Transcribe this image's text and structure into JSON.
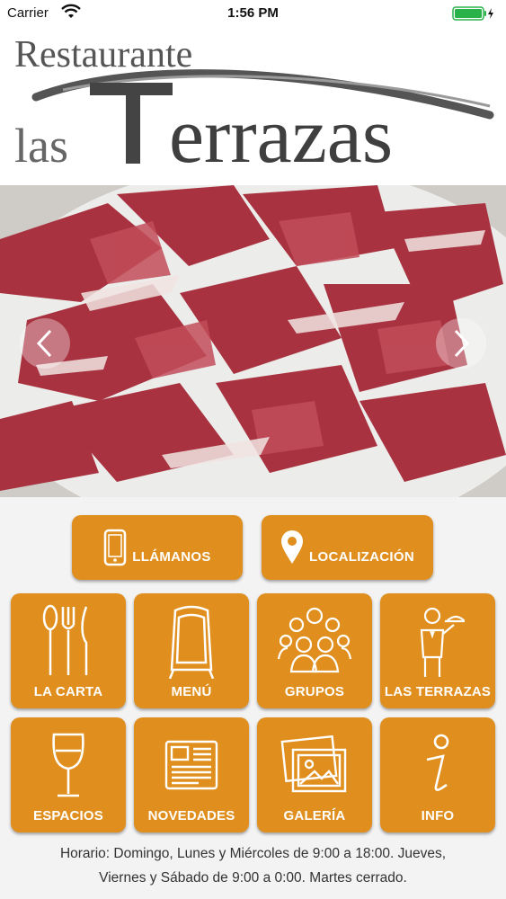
{
  "status_bar": {
    "carrier": "Carrier",
    "time": "1:56 PM"
  },
  "logo": {
    "line1": "Restaurante",
    "line2_small": "las",
    "line2_big": "errazas",
    "brand_color": "#4a4a4a"
  },
  "carousel": {
    "image_description_icon": "jamon-photo",
    "prev_icon": "chevron-left-icon",
    "next_icon": "chevron-right-icon"
  },
  "actions": {
    "call_label": "LLÁMANOS",
    "location_label": "LOCALIZACIÓN"
  },
  "tiles": [
    {
      "label": "LA CARTA",
      "icon": "cutlery-icon"
    },
    {
      "label": "MENÚ",
      "icon": "menu-board-icon"
    },
    {
      "label": "GRUPOS",
      "icon": "group-icon"
    },
    {
      "label": "LAS TERRAZAS",
      "icon": "waiter-icon"
    },
    {
      "label": "ESPACIOS",
      "icon": "wine-glass-icon"
    },
    {
      "label": "NOVEDADES",
      "icon": "newspaper-icon"
    },
    {
      "label": "GALERÍA",
      "icon": "gallery-icon"
    },
    {
      "label": "INFO",
      "icon": "info-icon"
    }
  ],
  "footer": {
    "line1": "Horario: Domingo, Lunes y Miércoles de 9:00 a 18:00. Jueves,",
    "line2": "Viernes y Sábado de 9:00 a 0:00. Martes cerrado."
  },
  "colors": {
    "accent": "#e08f1e",
    "background": "#f3f3f3"
  }
}
